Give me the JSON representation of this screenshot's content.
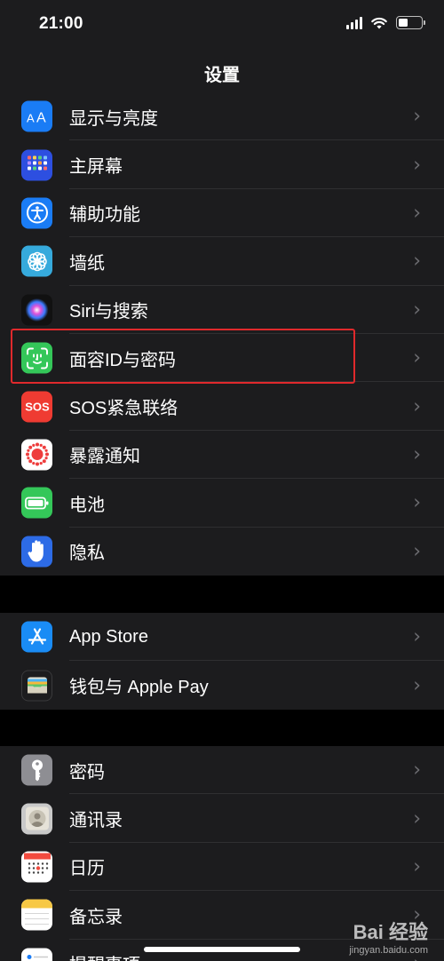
{
  "status_bar": {
    "time": "21:00"
  },
  "nav": {
    "title": "设置"
  },
  "groups": [
    {
      "items": [
        {
          "label": "显示与亮度",
          "icon": "display-brightness-icon",
          "color": "#1a7cf5"
        },
        {
          "label": "主屏幕",
          "icon": "home-screen-icon",
          "color": "#2d4fe0"
        },
        {
          "label": "辅助功能",
          "icon": "accessibility-icon",
          "color": "#1a7cf5"
        },
        {
          "label": "墙纸",
          "icon": "wallpaper-icon",
          "color": "#36aadc"
        },
        {
          "label": "Siri与搜索",
          "icon": "siri-icon",
          "color": "#111111"
        },
        {
          "label": "面容ID与密码",
          "icon": "face-id-icon",
          "color": "#34c759"
        },
        {
          "label": "SOS紧急联络",
          "icon": "sos-icon",
          "color": "#ef3b32"
        },
        {
          "label": "暴露通知",
          "icon": "exposure-notification-icon",
          "color": "#ffffff"
        },
        {
          "label": "电池",
          "icon": "battery-icon",
          "color": "#34c759"
        },
        {
          "label": "隐私",
          "icon": "privacy-hand-icon",
          "color": "#2d6be6"
        }
      ]
    },
    {
      "items": [
        {
          "label": "App Store",
          "icon": "app-store-icon",
          "color": "#1a8cf5"
        },
        {
          "label": "钱包与 Apple Pay",
          "icon": "wallet-icon",
          "color": "#1c1c1e"
        }
      ]
    },
    {
      "items": [
        {
          "label": "密码",
          "icon": "key-icon",
          "color": "#8e8e93"
        },
        {
          "label": "通讯录",
          "icon": "contacts-icon",
          "color": "#c9c9c9"
        },
        {
          "label": "日历",
          "icon": "calendar-icon",
          "color": "#ffffff"
        },
        {
          "label": "备忘录",
          "icon": "notes-icon",
          "color": "#ffffff"
        },
        {
          "label": "提醒事项",
          "icon": "reminders-icon",
          "color": "#ffffff"
        }
      ]
    }
  ],
  "chevron": "›",
  "highlight_color": "#e0292c",
  "watermark": {
    "logo": "Bai 经验",
    "url": "jingyan.baidu.com"
  }
}
